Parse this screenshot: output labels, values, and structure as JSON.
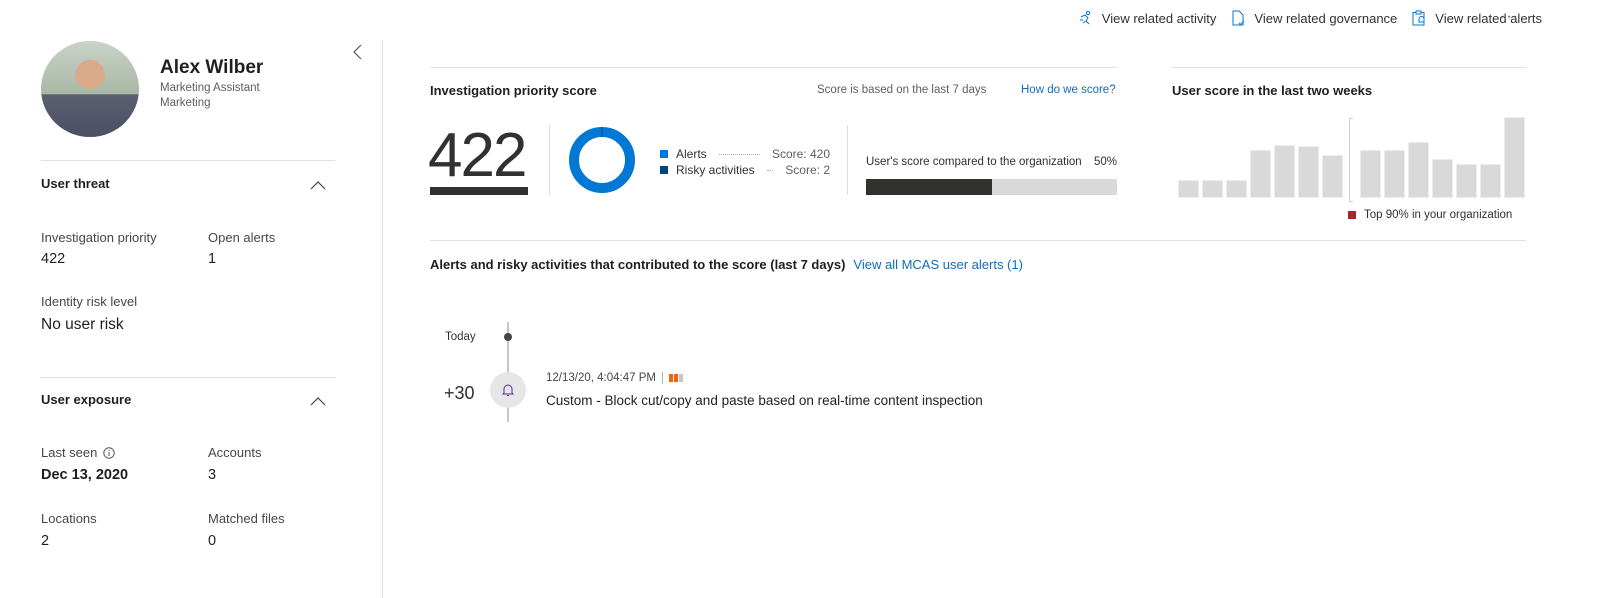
{
  "toolbar": {
    "actions": [
      {
        "label": "View related activity",
        "icon": "activity-icon"
      },
      {
        "label": "View related governance",
        "icon": "document-check-icon"
      },
      {
        "label": "View related alerts",
        "icon": "clipboard-alert-icon"
      }
    ],
    "more": "···"
  },
  "user": {
    "name": "Alex Wilber",
    "title": "Marketing Assistant",
    "department": "Marketing"
  },
  "threat": {
    "title": "User threat",
    "investigation_priority_label": "Investigation priority",
    "investigation_priority": "422",
    "open_alerts_label": "Open alerts",
    "open_alerts": "1",
    "identity_risk_label": "Identity risk level",
    "identity_risk": "No user risk"
  },
  "exposure": {
    "title": "User exposure",
    "last_seen_label": "Last seen",
    "last_seen": "Dec 13, 2020",
    "accounts_label": "Accounts",
    "accounts": "3",
    "locations_label": "Locations",
    "locations": "2",
    "matched_files_label": "Matched files",
    "matched_files": "0"
  },
  "score": {
    "title": "Investigation priority score",
    "note": "Score is based on the last 7 days",
    "how_link": "How do we score?",
    "value": "422",
    "legend": [
      {
        "label": "Alerts",
        "score": "Score: 420",
        "color": "#0078d4"
      },
      {
        "label": "Risky activities",
        "score": "Score: 2",
        "color": "#004578"
      }
    ],
    "compare_label": "User's score compared to the organization",
    "compare_pct": "50%",
    "compare_fraction": 0.5
  },
  "chart_data": {
    "type": "bar",
    "title": "User score in the last two weeks",
    "values": [
      18,
      18,
      18,
      47,
      52,
      51,
      42,
      47,
      47,
      55,
      38,
      33,
      33,
      79
    ],
    "legend": "Top 90% in your organization",
    "legend_color": "#a4262c",
    "bar_color": "#d9d9d9"
  },
  "alerts": {
    "title": "Alerts and risky activities that contributed to the score (last 7 days)",
    "view_all": "View all MCAS user alerts (1)",
    "today_label": "Today",
    "items": [
      {
        "points": "+30",
        "time": "12/13/20, 4:04:47 PM",
        "separator": "|",
        "name": "Custom - Block cut/copy and paste based on real-time content inspection",
        "severity": "medium"
      }
    ]
  }
}
